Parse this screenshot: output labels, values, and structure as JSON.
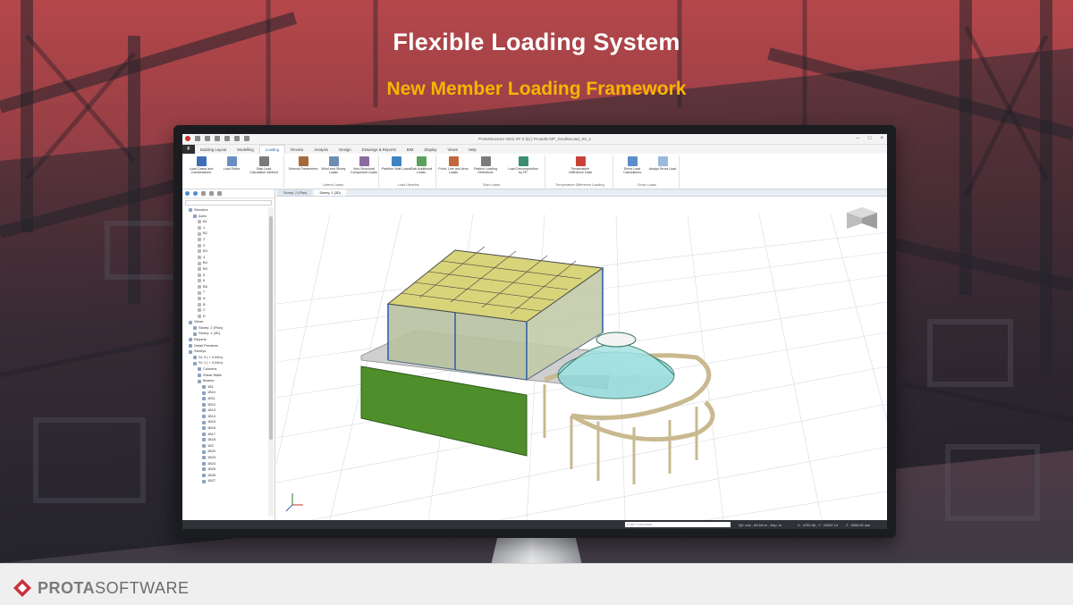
{
  "slide": {
    "title": "Flexible Loading System",
    "subtitle": "New Member Loading Framework",
    "colors": {
      "title": "#ffffff",
      "subtitle": "#f7b500",
      "background_top": "#b5474a",
      "background_bottom": "#3f3a44"
    }
  },
  "app": {
    "window_title": "ProtaStructure 2022 SP 0 (5) | Prota3D.MP_DoubleLoad_S0_1",
    "file_tab": "F",
    "tabs": [
      "Building Layout",
      "Modelling",
      "Loading",
      "Review",
      "Analysis",
      "Design",
      "Drawings & Reports",
      "BIM",
      "Display",
      "Views",
      "Help"
    ],
    "active_tab": "Loading",
    "ribbon_groups": [
      {
        "label": "",
        "buttons": [
          "Load Cases and Combinations",
          "Load Editor",
          "Slab Load Calculation Method"
        ]
      },
      {
        "label": "Lateral Loads",
        "buttons": [
          "Seismic Parameters",
          "Wind and Storey Loads",
          "Non-Structural Component Loads"
        ]
      },
      {
        "label": "Load Libraries",
        "buttons": [
          "Partition Wall Loads",
          "Slab Additional Loads"
        ]
      },
      {
        "label": "Slab Loads",
        "buttons": [
          "Point, Line and Area Loads",
          "Pattern Loading Definitions",
          "Load Decomposition by FE"
        ]
      },
      {
        "label": "Temperature Difference Loading",
        "buttons": [
          "Temperature Difference Data"
        ]
      },
      {
        "label": "Snow Loads",
        "buttons": [
          "Snow Load Calculations",
          "Assign Snow Load"
        ]
      }
    ],
    "tree": [
      "Structure",
      "Axes",
      "B1",
      "1",
      "B2",
      "2",
      "3",
      "B3",
      "4",
      "B4",
      "B5",
      "5",
      "6",
      "B6",
      "7",
      "A",
      "B",
      "C",
      "D",
      "Views",
      "Storey: 2 (Plan)",
      "Storey: 1 (3D)",
      "Reports",
      "Detail Previews",
      "Storeys",
      "St: 0 ( + 0.00m)",
      "St: 1 ( + 3.00m)",
      "Columns",
      "Shear Walls",
      "Beams",
      "1B1",
      "1B10",
      "1B11",
      "1B12",
      "1B13",
      "1B14",
      "1B15",
      "1B16",
      "1B17",
      "1B18",
      "1B2",
      "1B20",
      "1B23",
      "1B24",
      "1B25",
      "1B26",
      "1B27"
    ],
    "doc_tabs": [
      "Storey: 2 (Plan)",
      "Storey: 1 (3D)"
    ],
    "active_doc_tab": "Storey: 1 (3D)",
    "status": {
      "command_placeholder": "Enter Command",
      "units": "Q0: mm , kN  kN·m , Dep: m",
      "coords": "X : 4750.36 , Y : 12087.14",
      "zoom": "Z : 3000.00 mm"
    }
  },
  "brand": {
    "logo_bold": "PROTA",
    "logo_light": "SOFTWARE"
  }
}
